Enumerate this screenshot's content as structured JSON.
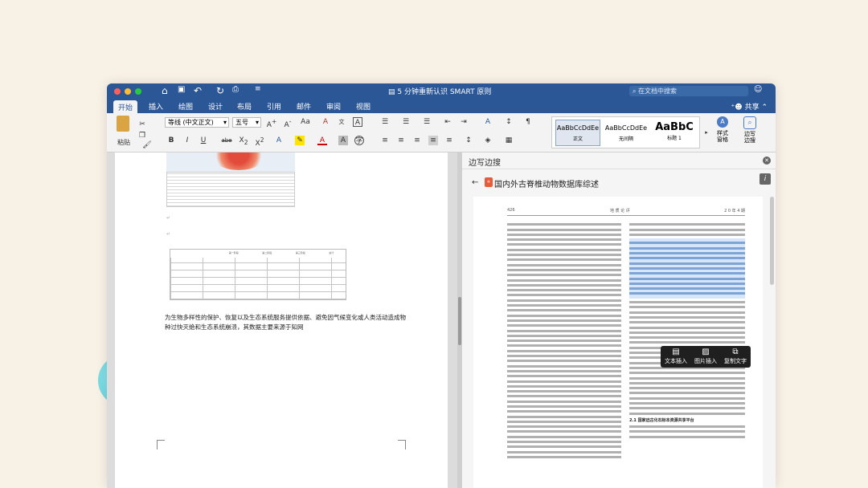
{
  "window": {
    "doc_title": "5 分钟重新认识 SMART 原则",
    "search_placeholder": "在文档中搜索"
  },
  "menu": {
    "tabs": [
      "开始",
      "插入",
      "绘图",
      "设计",
      "布局",
      "引用",
      "邮件",
      "审阅",
      "视图"
    ],
    "share": "共享"
  },
  "ribbon": {
    "paste": "粘贴",
    "font_name": "等线 (中文正文)",
    "font_size": "五号",
    "styles": [
      {
        "preview": "AaBbCcDdEe",
        "name": "正文"
      },
      {
        "preview": "AaBbCcDdEe",
        "name": "无间隔"
      },
      {
        "preview": "AaBbC",
        "name": "标题 1"
      }
    ],
    "styles_pane": "样式\n窗格",
    "write_side": "边写\n边搜"
  },
  "document": {
    "table_headers": [
      "第一阶段",
      "第二阶段",
      "第三阶段",
      "总计"
    ],
    "body_text": "为生物多样性的保护、恢复以及生态系统服务提供依据、避免因气候变化或人类活动造成物种过快灭绝和生态系统崩溃，其数据主要来源于知网"
  },
  "side_pane": {
    "header": "边写边搜",
    "paper_title": "国内外古脊椎动物数据库综述",
    "page_header_left": "426",
    "page_header_mid": "地 质 论 评",
    "page_header_right": "2 0 年 4 期",
    "section": "2.1 国家远古化石标本资源共享平台",
    "float_buttons": [
      "文本插入",
      "图片插入",
      "复制文字"
    ]
  }
}
